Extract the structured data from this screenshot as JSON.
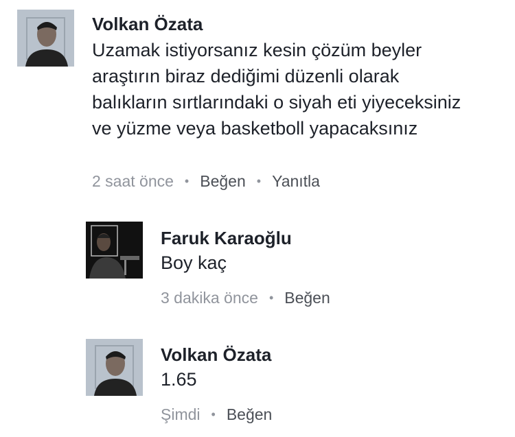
{
  "comments": [
    {
      "author": "Volkan Özata",
      "text": "Uzamak istiyorsanız kesin çözüm beyler araştırın biraz dediğimi düzenli olarak balıkların sırtlarındaki o siyah eti yiyeceksiniz ve yüzme veya basketboll yapacaksınız",
      "time": "2 saat önce",
      "like_label": "Beğen",
      "reply_label": "Yanıtla",
      "avatar_icon": "profile-photo-icon"
    },
    {
      "author": "Faruk Karaoğlu",
      "text": "Boy kaç",
      "time": "3 dakika önce",
      "like_label": "Beğen",
      "avatar_icon": "profile-photo-icon"
    },
    {
      "author": "Volkan Özata",
      "text": "1.65",
      "time": "Şimdi",
      "like_label": "Beğen",
      "avatar_icon": "profile-photo-icon"
    }
  ],
  "colors": {
    "author": "#1d2129",
    "text": "#1d2129",
    "meta": "#90949c",
    "action": "#4b4f56"
  }
}
